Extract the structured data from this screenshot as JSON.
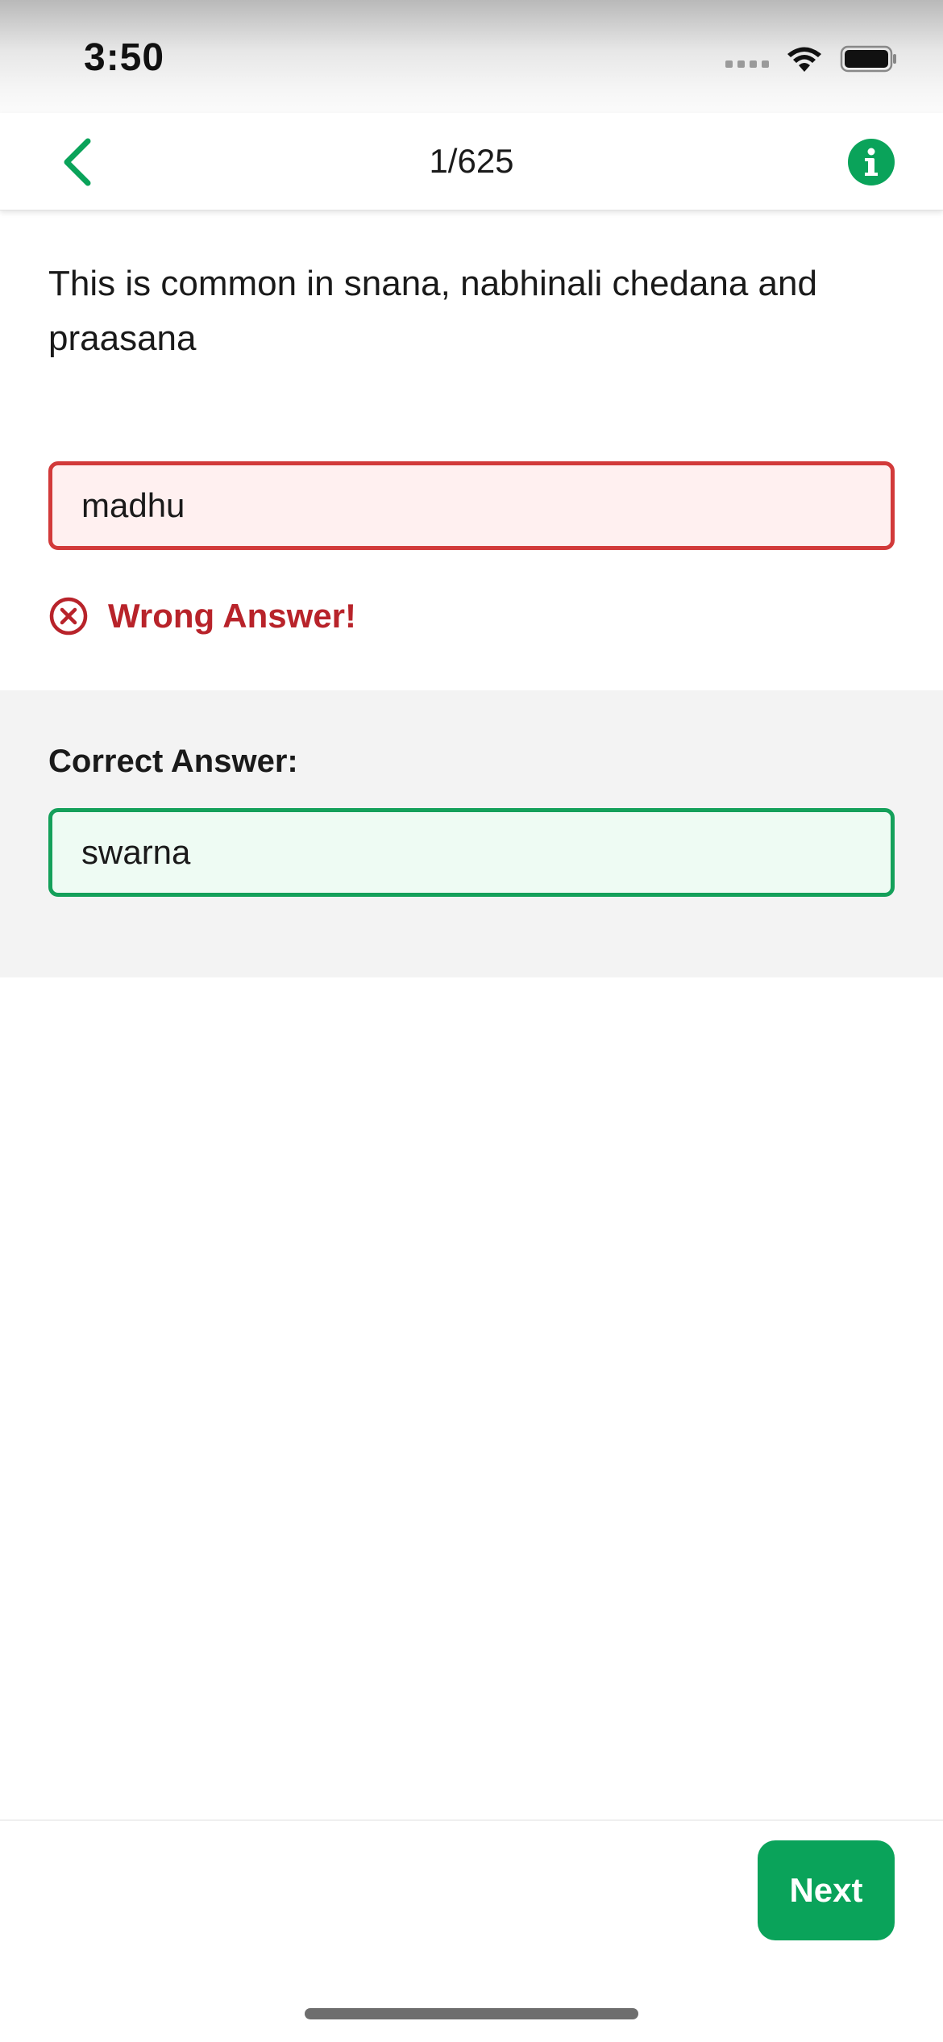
{
  "status_bar": {
    "time": "3:50"
  },
  "nav": {
    "title": "1/625"
  },
  "question": {
    "text": "This is common in snana, nabhinali chedana and praasana"
  },
  "user_answer": {
    "value": "madhu",
    "feedback": "Wrong Answer!"
  },
  "correct": {
    "label": "Correct Answer:",
    "value": "swarna"
  },
  "footer": {
    "next_label": "Next"
  },
  "colors": {
    "accent_green": "#0aa35a",
    "error_red": "#b8232a",
    "error_border": "#d23a3a",
    "success_border": "#14a05a"
  },
  "icons": {
    "back": "chevron-left-icon",
    "info": "info-icon",
    "wrong": "x-circle-icon",
    "wifi": "wifi-icon",
    "battery": "battery-icon",
    "signal": "signal-icon"
  }
}
